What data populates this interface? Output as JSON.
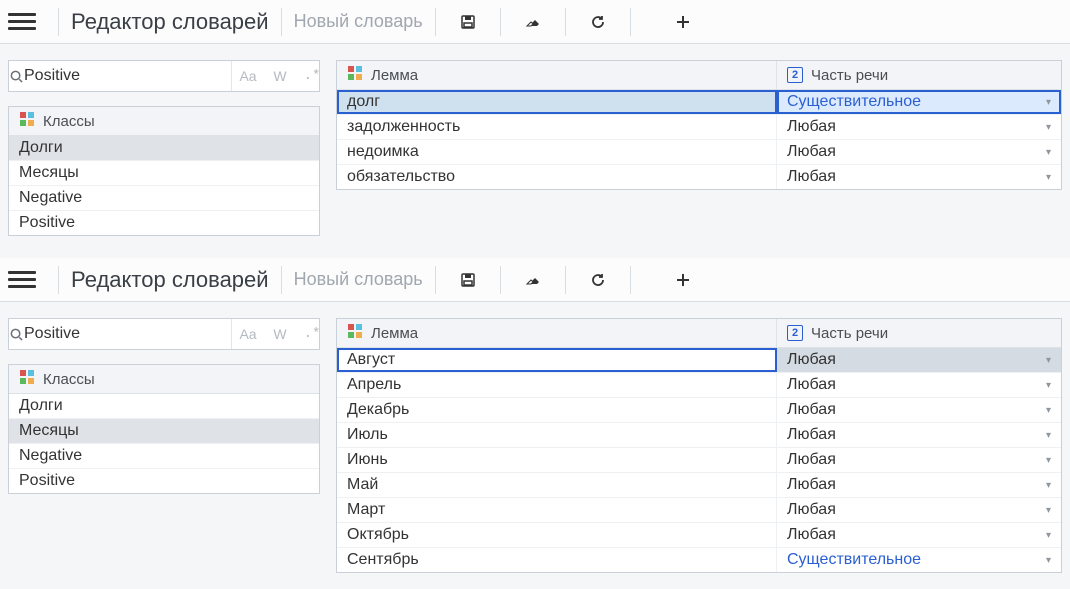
{
  "panels": [
    {
      "title": "Редактор словарей",
      "subtitle": "Новый словарь",
      "search": {
        "value": "Positive",
        "filter_aa": "Aa",
        "filter_w": "W",
        "filter_regex": ".*"
      },
      "classes_header": "Классы",
      "classes": [
        {
          "label": "Долги",
          "selected": true
        },
        {
          "label": "Месяцы",
          "selected": false
        },
        {
          "label": "Negative",
          "selected": false
        },
        {
          "label": "Positive",
          "selected": false
        }
      ],
      "col_lemma": "Лемма",
      "col_pos": "Часть речи",
      "pos_badge": "2",
      "rows": [
        {
          "lemma": "долг",
          "pos": "Существительное",
          "style": "selected-blue"
        },
        {
          "lemma": "задолженность",
          "pos": "Любая",
          "style": ""
        },
        {
          "lemma": "недоимка",
          "pos": "Любая",
          "style": ""
        },
        {
          "lemma": "обязательство",
          "pos": "Любая",
          "style": ""
        }
      ]
    },
    {
      "title": "Редактор словарей",
      "subtitle": "Новый словарь",
      "search": {
        "value": "Positive",
        "filter_aa": "Aa",
        "filter_w": "W",
        "filter_regex": ".*"
      },
      "classes_header": "Классы",
      "classes": [
        {
          "label": "Долги",
          "selected": false
        },
        {
          "label": "Месяцы",
          "selected": true
        },
        {
          "label": "Negative",
          "selected": false
        },
        {
          "label": "Positive",
          "selected": false
        }
      ],
      "col_lemma": "Лемма",
      "col_pos": "Часть речи",
      "pos_badge": "2",
      "rows": [
        {
          "lemma": "Август",
          "pos": "Любая",
          "style": "active-sel"
        },
        {
          "lemma": "Апрель",
          "pos": "Любая",
          "style": ""
        },
        {
          "lemma": "Декабрь",
          "pos": "Любая",
          "style": ""
        },
        {
          "lemma": "Июль",
          "pos": "Любая",
          "style": ""
        },
        {
          "lemma": "Июнь",
          "pos": "Любая",
          "style": ""
        },
        {
          "lemma": "Май",
          "pos": "Любая",
          "style": ""
        },
        {
          "lemma": "Март",
          "pos": "Любая",
          "style": ""
        },
        {
          "lemma": "Октябрь",
          "pos": "Любая",
          "style": ""
        },
        {
          "lemma": "Сентябрь",
          "pos": "Существительное",
          "style": "blue-pos"
        }
      ]
    }
  ]
}
